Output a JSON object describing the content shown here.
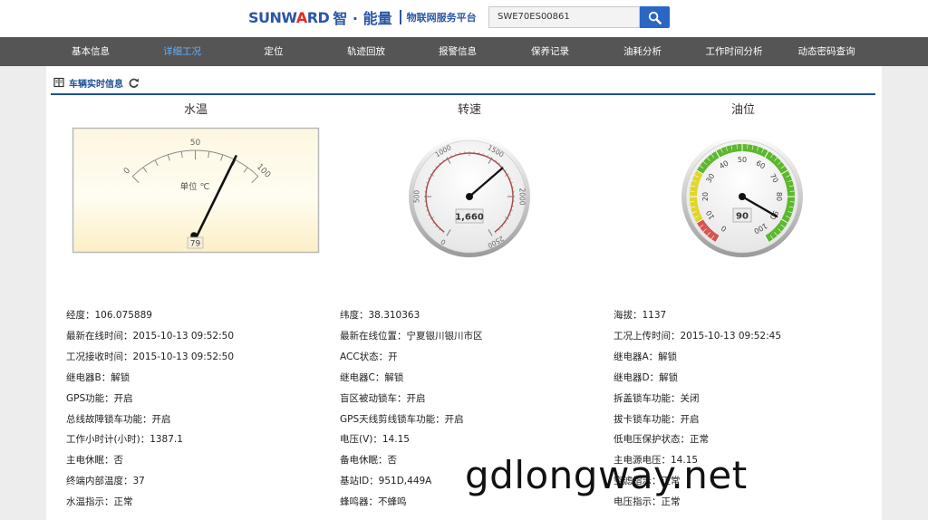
{
  "header": {
    "logo_en_main": "SUNW",
    "logo_en_accent": "A",
    "logo_en_tail": "RD",
    "logo_cn": "智 · 能量",
    "logo_sub": "物联网服务平台",
    "search_value": "SWE70ES00861"
  },
  "nav": {
    "items": [
      "基本信息",
      "详细工况",
      "定位",
      "轨迹回放",
      "报警信息",
      "保养记录",
      "油耗分析",
      "工作时间分析",
      "动态密码查询"
    ],
    "active": 1
  },
  "panel": {
    "title": "车辆实时信息"
  },
  "gauges": {
    "water_temp": {
      "title": "水温",
      "unit_label": "单位 ℃",
      "min": 0,
      "max": 100,
      "ticks": [
        "0",
        "50",
        "100"
      ],
      "value": 79,
      "display": "79"
    },
    "rpm": {
      "title": "转速",
      "min": 0,
      "max": 2500,
      "ticks": [
        "0",
        "500",
        "1000",
        "1500",
        "2000",
        "2500"
      ],
      "value": 1660,
      "display": "1,660"
    },
    "fuel": {
      "title": "油位",
      "min": 0,
      "max": 100,
      "ticks": [
        "0",
        "10",
        "20",
        "30",
        "40",
        "50",
        "60",
        "70",
        "80",
        "90",
        "100"
      ],
      "value": 90,
      "display": "90"
    }
  },
  "info": {
    "col1": [
      "经度：106.075889",
      "最新在线时间：2015-10-13 09:52:50",
      "工况接收时间：2015-10-13 09:52:50",
      "继电器B：解锁",
      "GPS功能：开启",
      "总线故障锁车功能：开启",
      "工作小时计(小时)：1387.1",
      "主电休眠：否",
      "终端内部温度：37",
      "水温指示：正常"
    ],
    "col2": [
      "纬度：38.310363",
      "最新在线位置：宁夏银川银川市区",
      "ACC状态：开",
      "继电器C：解锁",
      "盲区被动锁车：开启",
      "GPS天线剪线锁车功能：开启",
      "电压(V)：14.15",
      "备电休眠：否",
      "基站ID：951D,449A",
      "蜂鸣器：不蜂鸣"
    ],
    "col3": [
      "海拔：1137",
      "工况上传时间：2015-10-13 09:52:45",
      "继电器A：解锁",
      "继电器D：解锁",
      "拆盖锁车功能：关闭",
      "拔卡锁车功能：开启",
      "低电压保护状态：正常",
      "主电源电压：14.15",
      "空滤指示：正常",
      "电压指示：正常"
    ]
  },
  "watermark": "gdlongway.net",
  "colors": {
    "brand_blue": "#2a56a6",
    "nav_bg": "#555555",
    "nav_active": "#5fb3ff",
    "search_button": "#2a66c4",
    "gauge_red": "#d9534f",
    "gauge_yellow": "#dfd62b",
    "gauge_green": "#5cb82e"
  }
}
